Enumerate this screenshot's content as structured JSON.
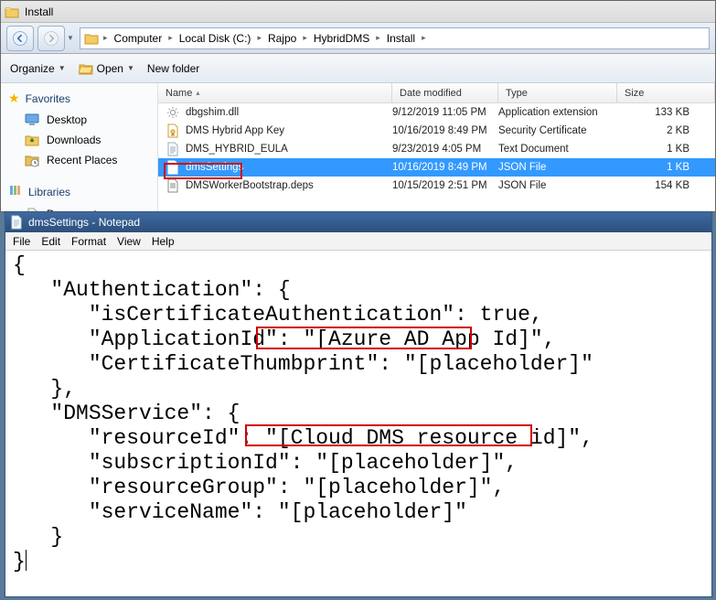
{
  "explorer": {
    "title": "Install",
    "path": [
      "Computer",
      "Local Disk (C:)",
      "Rajpo",
      "HybridDMS",
      "Install"
    ],
    "toolbar": {
      "organize": "Organize",
      "open": "Open",
      "newfolder": "New folder"
    },
    "nav": {
      "favorites_label": "Favorites",
      "items": [
        "Desktop",
        "Downloads",
        "Recent Places"
      ],
      "libraries_label": "Libraries",
      "lib_items": [
        "Documents"
      ]
    },
    "columns": {
      "name": "Name",
      "date": "Date modified",
      "type": "Type",
      "size": "Size"
    },
    "files": [
      {
        "name": "dbgshim.dll",
        "date": "9/12/2019 11:05 PM",
        "type": "Application extension",
        "size": "133 KB",
        "icon": "gear"
      },
      {
        "name": "DMS Hybrid App Key",
        "date": "10/16/2019 8:49 PM",
        "type": "Security Certificate",
        "size": "2 KB",
        "icon": "cert"
      },
      {
        "name": "DMS_HYBRID_EULA",
        "date": "9/23/2019 4:05 PM",
        "type": "Text Document",
        "size": "1 KB",
        "icon": "txt"
      },
      {
        "name": "dmsSettings",
        "date": "10/16/2019 8:49 PM",
        "type": "JSON File",
        "size": "1 KB",
        "icon": "json",
        "selected": true
      },
      {
        "name": "DMSWorkerBootstrap.deps",
        "date": "10/15/2019 2:51 PM",
        "type": "JSON File",
        "size": "154 KB",
        "icon": "json"
      }
    ]
  },
  "notepad": {
    "title": "dmsSettings - Notepad",
    "menus": [
      "File",
      "Edit",
      "Format",
      "View",
      "Help"
    ],
    "content": "{\n   \"Authentication\": {\n      \"isCertificateAuthentication\": true,\n      \"ApplicationId\": \"[Azure AD App Id]\",\n      \"CertificateThumbprint\": \"[placeholder]\"\n   },\n   \"DMSService\": {\n      \"resourceId\": \"[Cloud DMS resource id]\",\n      \"subscriptionId\": \"[placeholder]\",\n      \"resourceGroup\": \"[placeholder]\",\n      \"serviceName\": \"[placeholder]\"\n   }\n}"
  }
}
